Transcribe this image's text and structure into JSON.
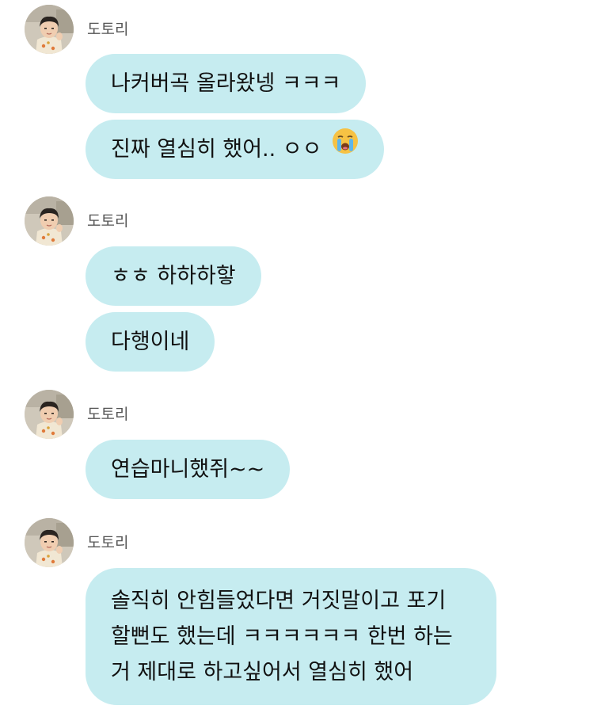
{
  "chat": {
    "groups": [
      {
        "sender": "도토리",
        "messages": [
          {
            "text": "나커버곡 올라왔넹 ㅋㅋㅋ"
          },
          {
            "text": "진짜 열심히 했어.. ㅇㅇ",
            "emoji": "loudly-crying-face"
          }
        ]
      },
      {
        "sender": "도토리",
        "messages": [
          {
            "text": "ㅎㅎ 하하하핳"
          },
          {
            "text": "다행이네"
          }
        ]
      },
      {
        "sender": "도토리",
        "messages": [
          {
            "text": "연습마니했쥐~~"
          }
        ]
      },
      {
        "sender": "도토리",
        "messages": [
          {
            "lines": [
              "솔직히 안힘들었다면 거짓말이고 포기",
              "할뻔도 했는데 ㅋㅋㅋㅋㅋㅋ 한번 하는",
              "거 제대로 하고싶어서 열심히 했어"
            ]
          }
        ]
      }
    ]
  },
  "colors": {
    "bubble": "#c6ecf0",
    "sender_name": "#555555",
    "text": "#111111",
    "background": "#ffffff"
  },
  "icons": {
    "avatar": "profile-photo-child",
    "emoji": "loudly-crying-face"
  }
}
